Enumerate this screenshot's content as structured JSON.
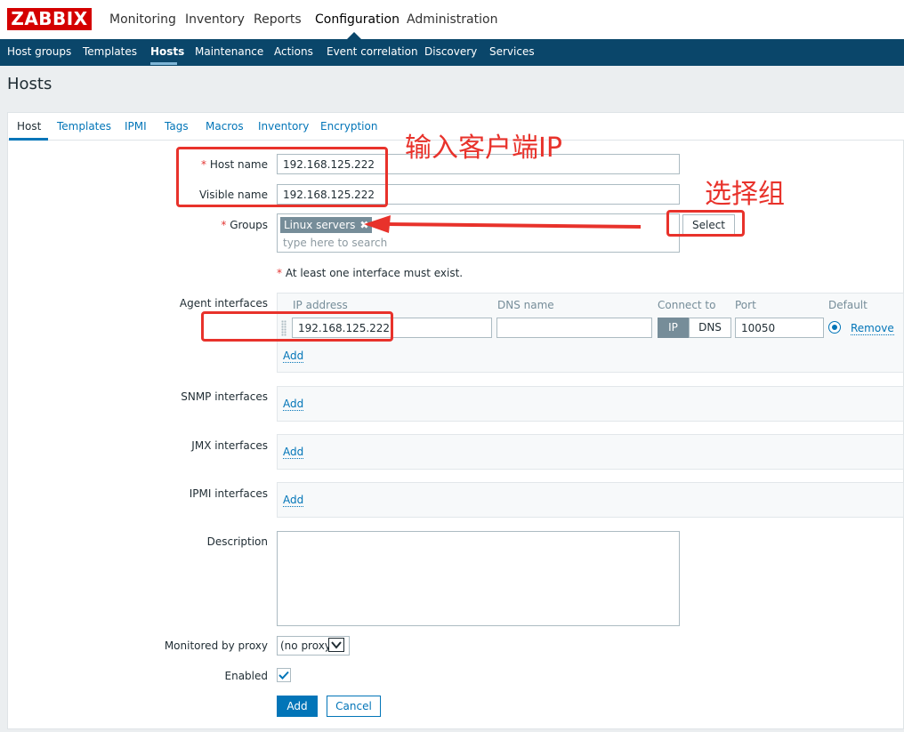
{
  "app": {
    "logo": "ZABBIX"
  },
  "main_nav": [
    {
      "label": "Monitoring"
    },
    {
      "label": "Inventory"
    },
    {
      "label": "Reports"
    },
    {
      "label": "Configuration",
      "active": true
    },
    {
      "label": "Administration"
    }
  ],
  "sub_nav": [
    {
      "label": "Host groups"
    },
    {
      "label": "Templates"
    },
    {
      "label": "Hosts",
      "active": true
    },
    {
      "label": "Maintenance"
    },
    {
      "label": "Actions"
    },
    {
      "label": "Event correlation"
    },
    {
      "label": "Discovery"
    },
    {
      "label": "Services"
    }
  ],
  "page": {
    "title": "Hosts"
  },
  "tabs": [
    {
      "label": "Host",
      "active": true
    },
    {
      "label": "Templates"
    },
    {
      "label": "IPMI"
    },
    {
      "label": "Tags"
    },
    {
      "label": "Macros"
    },
    {
      "label": "Inventory"
    },
    {
      "label": "Encryption"
    }
  ],
  "form": {
    "required_marker": "*",
    "host_name": {
      "label": "Host name",
      "value": "192.168.125.222"
    },
    "visible_name": {
      "label": "Visible name",
      "value": "192.168.125.222"
    },
    "groups": {
      "label": "Groups",
      "selected": [
        "Linux servers"
      ],
      "remove_glyph": "✖",
      "placeholder": "type here to search",
      "select_button": "Select"
    },
    "interface_notice": "At least one interface must exist.",
    "agent_interfaces": {
      "label": "Agent interfaces",
      "columns": {
        "ip": "IP address",
        "dns": "DNS name",
        "connect": "Connect to",
        "port": "Port",
        "default": "Default"
      },
      "row": {
        "ip": "192.168.125.222",
        "dns": "",
        "connect_options": [
          "IP",
          "DNS"
        ],
        "connect_selected": "IP",
        "port": "10050",
        "default_selected": true,
        "remove_label": "Remove"
      },
      "add_label": "Add"
    },
    "snmp_interfaces": {
      "label": "SNMP interfaces",
      "add_label": "Add"
    },
    "jmx_interfaces": {
      "label": "JMX interfaces",
      "add_label": "Add"
    },
    "ipmi_interfaces": {
      "label": "IPMI interfaces",
      "add_label": "Add"
    },
    "description": {
      "label": "Description",
      "value": ""
    },
    "proxy": {
      "label": "Monitored by proxy",
      "selected": "(no proxy)"
    },
    "enabled": {
      "label": "Enabled",
      "checked": true,
      "check_glyph": "✔"
    },
    "buttons": {
      "add": "Add",
      "cancel": "Cancel"
    }
  },
  "annotations": {
    "client_ip": "输入客户端IP",
    "select_group": "选择组"
  },
  "colors": {
    "brand_red": "#d40000",
    "nav_dark": "#0a466a",
    "link_blue": "#0275b8",
    "annotation_red": "#e8322b"
  }
}
